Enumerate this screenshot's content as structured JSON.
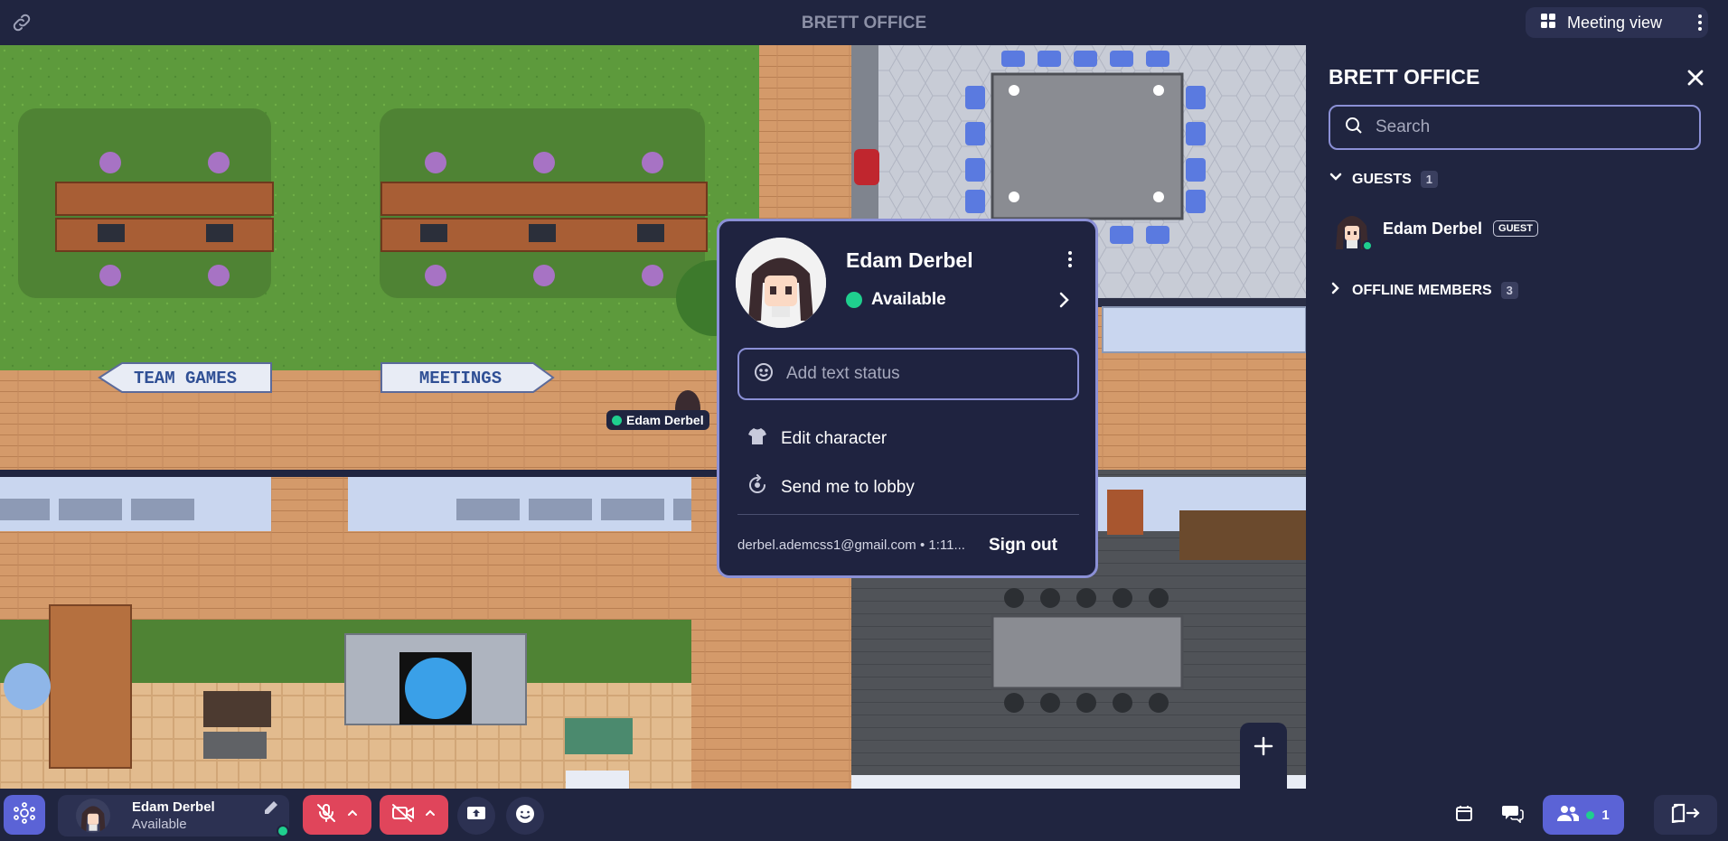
{
  "topbar": {
    "title": "BRETT OFFICE",
    "meeting_view_label": "Meeting view",
    "icons": [
      "link-icon",
      "grid-icon",
      "kebab-icon"
    ]
  },
  "map": {
    "signs": [
      "TEAM GAMES",
      "MEETINGS"
    ],
    "player_label": "Edam Derbel"
  },
  "sidebar": {
    "title": "BRETT OFFICE",
    "search_placeholder": "Search",
    "guests_label": "GUESTS",
    "guests_count": "1",
    "member_name": "Edam Derbel",
    "member_badge": "GUEST",
    "offline_label": "OFFLINE MEMBERS",
    "offline_count": "3"
  },
  "popup": {
    "name": "Edam Derbel",
    "status": "Available",
    "text_status_placeholder": "Add text status",
    "edit_character": "Edit character",
    "send_lobby": "Send me to lobby",
    "email": "derbel.ademcss1@gmail.com • 1:11...",
    "sign_out": "Sign out"
  },
  "bottombar": {
    "user_name": "Edam Derbel",
    "user_status": "Available",
    "participants_count": "1",
    "icons": [
      "logo-icon",
      "pencil-icon",
      "mic-off-icon",
      "camera-off-icon",
      "screen-share-icon",
      "emoji-icon",
      "calendar-icon",
      "chat-icon",
      "people-icon",
      "leave-icon"
    ]
  },
  "colors": {
    "bg": "#202540",
    "accent": "#5b63d6",
    "danger": "#e0455b",
    "online": "#1fcf8e",
    "border": "#8b90d6"
  }
}
